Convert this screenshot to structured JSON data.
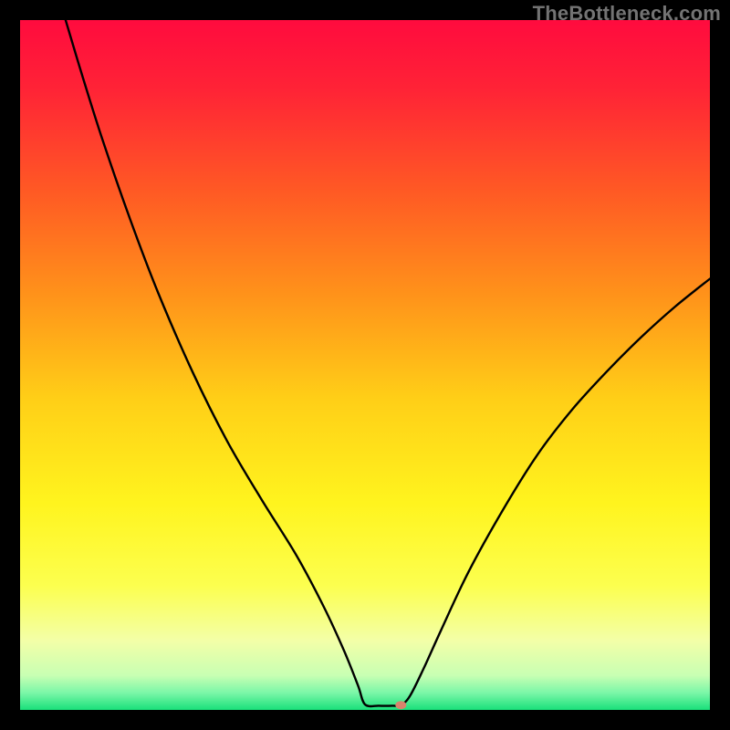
{
  "watermark": "TheBottleneck.com",
  "chart_data": {
    "type": "line",
    "title": "",
    "xlabel": "",
    "ylabel": "",
    "xlim": [
      0,
      100
    ],
    "ylim": [
      0,
      100
    ],
    "gradient_stops": [
      {
        "offset": 0.0,
        "color": "#ff0b3e"
      },
      {
        "offset": 0.1,
        "color": "#ff2336"
      },
      {
        "offset": 0.25,
        "color": "#ff5a24"
      },
      {
        "offset": 0.4,
        "color": "#ff931a"
      },
      {
        "offset": 0.55,
        "color": "#ffcf17"
      },
      {
        "offset": 0.7,
        "color": "#fff41e"
      },
      {
        "offset": 0.82,
        "color": "#fcff4f"
      },
      {
        "offset": 0.9,
        "color": "#f3ffa8"
      },
      {
        "offset": 0.95,
        "color": "#c8ffb3"
      },
      {
        "offset": 0.975,
        "color": "#7cf7a8"
      },
      {
        "offset": 1.0,
        "color": "#19e07a"
      }
    ],
    "curve_points": [
      {
        "x": 6.6,
        "y": 100.0
      },
      {
        "x": 9.0,
        "y": 92.0
      },
      {
        "x": 12.0,
        "y": 82.5
      },
      {
        "x": 16.0,
        "y": 71.0
      },
      {
        "x": 20.0,
        "y": 60.5
      },
      {
        "x": 25.0,
        "y": 49.0
      },
      {
        "x": 30.0,
        "y": 39.0
      },
      {
        "x": 35.0,
        "y": 30.5
      },
      {
        "x": 40.0,
        "y": 22.5
      },
      {
        "x": 44.0,
        "y": 15.0
      },
      {
        "x": 47.0,
        "y": 8.5
      },
      {
        "x": 49.0,
        "y": 3.5
      },
      {
        "x": 50.0,
        "y": 0.8
      },
      {
        "x": 52.0,
        "y": 0.6
      },
      {
        "x": 54.0,
        "y": 0.6
      },
      {
        "x": 55.2,
        "y": 0.7
      },
      {
        "x": 56.5,
        "y": 2.0
      },
      {
        "x": 58.5,
        "y": 6.0
      },
      {
        "x": 61.0,
        "y": 11.5
      },
      {
        "x": 65.0,
        "y": 20.0
      },
      {
        "x": 70.0,
        "y": 29.0
      },
      {
        "x": 75.0,
        "y": 37.0
      },
      {
        "x": 80.0,
        "y": 43.5
      },
      {
        "x": 85.0,
        "y": 49.0
      },
      {
        "x": 90.0,
        "y": 54.0
      },
      {
        "x": 95.0,
        "y": 58.5
      },
      {
        "x": 100.0,
        "y": 62.5
      }
    ],
    "marker": {
      "x": 55.2,
      "y": 0.7,
      "rx": 6,
      "ry": 4.5,
      "color": "#d8836c"
    }
  }
}
